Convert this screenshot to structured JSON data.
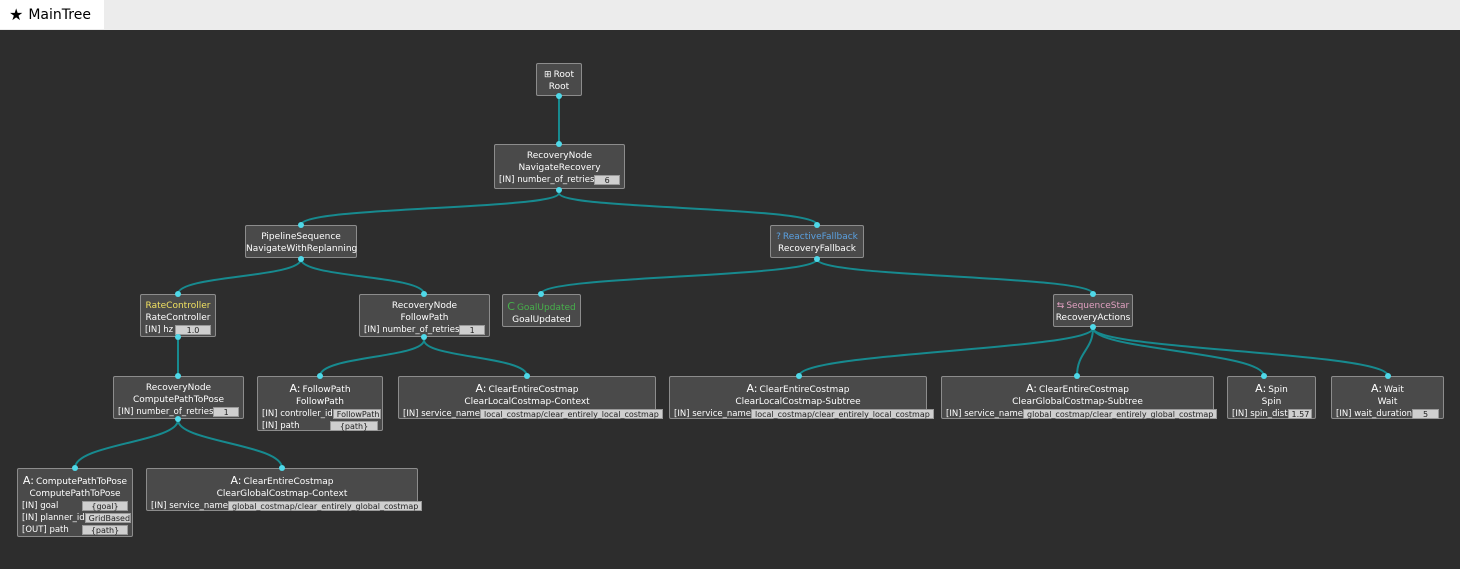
{
  "tab": {
    "icon": "star-icon",
    "label": "MainTree"
  },
  "colors": {
    "link": "#178a8f",
    "port_dot": "#4fd8e8",
    "rate": "#f0e060",
    "fallback": "#5aa0e0",
    "condition": "#47b04b",
    "sequence": "#e0a0c0"
  },
  "nodes": {
    "root": {
      "title": "Root",
      "sub": "Root",
      "icon": "tree-icon"
    },
    "navigate_recovery": {
      "title": "RecoveryNode",
      "sub": "NavigateRecovery",
      "p1n": "[IN] number_of_retries",
      "p1v": "6"
    },
    "pipeline": {
      "title": "PipelineSequence",
      "sub": "NavigateWithReplanning"
    },
    "fallback": {
      "title": "ReactiveFallback",
      "sub": "RecoveryFallback",
      "icon": "fallback-icon"
    },
    "rate": {
      "title": "RateController",
      "sub": "RateController",
      "p1n": "[IN] hz",
      "p1v": "1.0"
    },
    "followpath_rec": {
      "title": "RecoveryNode",
      "sub": "FollowPath",
      "p1n": "[IN] number_of_retries",
      "p1v": "1"
    },
    "goal_updated": {
      "title": "GoalUpdated",
      "sub": "GoalUpdated",
      "icon": "condition-icon"
    },
    "seqstar": {
      "title": "SequenceStar",
      "sub": "RecoveryActions",
      "icon": "sequence-icon"
    },
    "compute_rec": {
      "title": "RecoveryNode",
      "sub": "ComputePathToPose",
      "p1n": "[IN] number_of_retries",
      "p1v": "1"
    },
    "followpath": {
      "title": "FollowPath",
      "sub": "FollowPath",
      "p1n": "[IN] controller_id",
      "p1v": "FollowPath",
      "p2n": "[IN] path",
      "p2v": "{path}",
      "icon": "action-icon"
    },
    "clear_local_ctx": {
      "title": "ClearEntireCostmap",
      "sub": "ClearLocalCostmap-Context",
      "p1n": "[IN] service_name",
      "p1v": "local_costmap/clear_entirely_local_costmap",
      "icon": "action-icon"
    },
    "clear_local_sub": {
      "title": "ClearEntireCostmap",
      "sub": "ClearLocalCostmap-Subtree",
      "p1n": "[IN] service_name",
      "p1v": "local_costmap/clear_entirely_local_costmap",
      "icon": "action-icon"
    },
    "clear_global_sub": {
      "title": "ClearEntireCostmap",
      "sub": "ClearGlobalCostmap-Subtree",
      "p1n": "[IN] service_name",
      "p1v": "global_costmap/clear_entirely_global_costmap",
      "icon": "action-icon"
    },
    "spin": {
      "title": "Spin",
      "sub": "Spin",
      "p1n": "[IN] spin_dist",
      "p1v": "1.57",
      "icon": "action-icon"
    },
    "wait": {
      "title": "Wait",
      "sub": "Wait",
      "p1n": "[IN] wait_duration",
      "p1v": "5",
      "icon": "action-icon"
    },
    "compute": {
      "title": "ComputePathToPose",
      "sub": "ComputePathToPose",
      "p1n": "[IN] goal",
      "p1v": "{goal}",
      "p2n": "[IN] planner_id",
      "p2v": "GridBased",
      "p3n": "[OUT] path",
      "p3v": "{path}",
      "icon": "action-icon"
    },
    "clear_global_ctx": {
      "title": "ClearEntireCostmap",
      "sub": "ClearGlobalCostmap-Context",
      "p1n": "[IN] service_name",
      "p1v": "global_costmap/clear_entirely_global_costmap",
      "icon": "action-icon"
    }
  }
}
